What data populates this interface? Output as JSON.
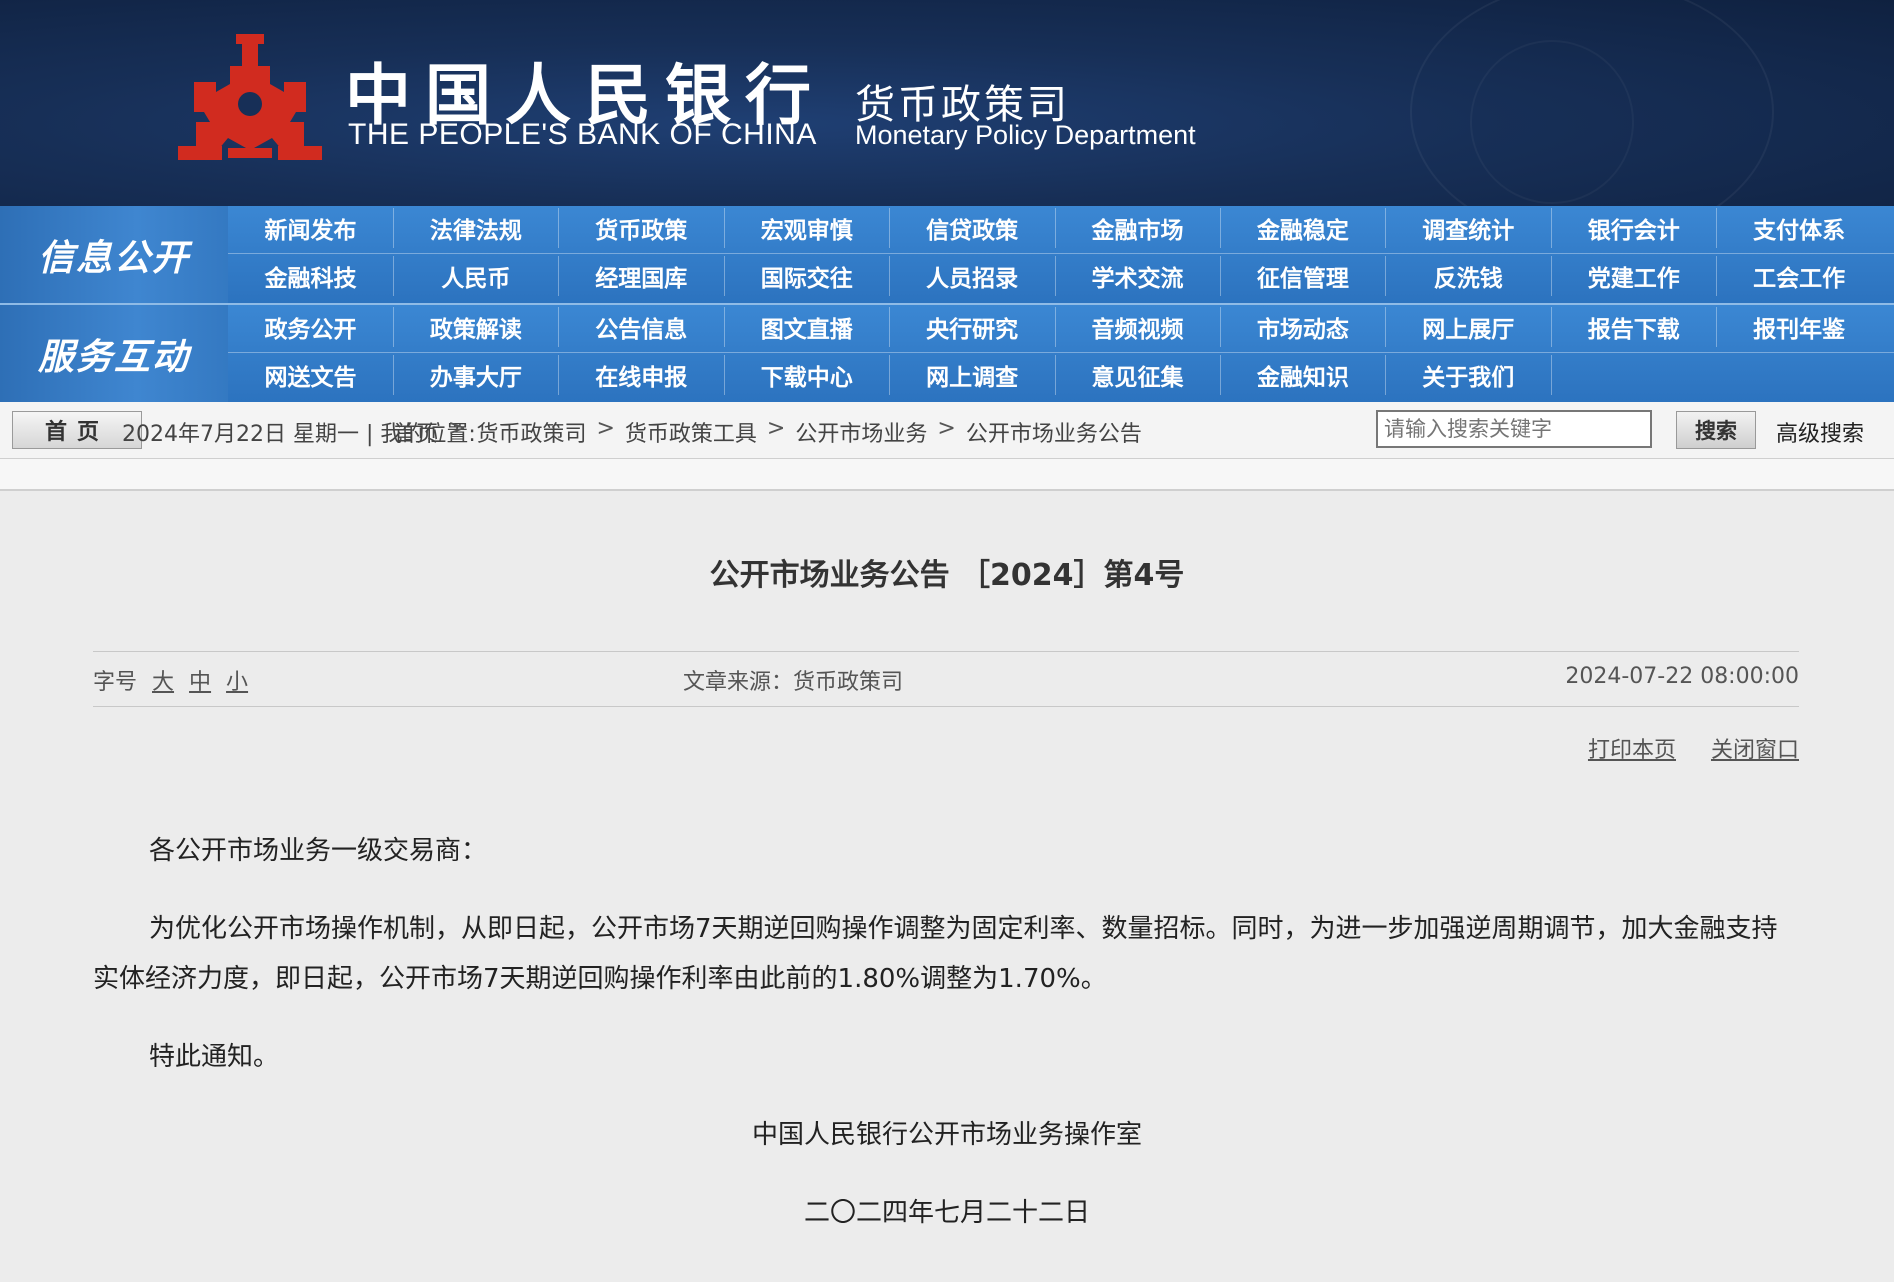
{
  "banner": {
    "bank_name_cn": "中国人民银行",
    "bank_name_en": "THE PEOPLE'S BANK OF CHINA",
    "dept_name_cn": "货币政策司",
    "dept_name_en": "Monetary Policy Department",
    "logo_icon": "pboc-logo-icon",
    "logo_color": "#d12b1f"
  },
  "nav": {
    "sections": [
      {
        "title": "信息公开",
        "rows": [
          [
            "新闻发布",
            "法律法规",
            "货币政策",
            "宏观审慎",
            "信贷政策",
            "金融市场",
            "金融稳定",
            "调查统计",
            "银行会计",
            "支付体系"
          ],
          [
            "金融科技",
            "人民币",
            "经理国库",
            "国际交往",
            "人员招录",
            "学术交流",
            "征信管理",
            "反洗钱",
            "党建工作",
            "工会工作"
          ]
        ]
      },
      {
        "title": "服务互动",
        "rows": [
          [
            "政务公开",
            "政策解读",
            "公告信息",
            "图文直播",
            "央行研究",
            "音频视频",
            "市场动态",
            "网上展厅",
            "报告下载",
            "报刊年鉴"
          ],
          [
            "网送文告",
            "办事大厅",
            "在线申报",
            "下载中心",
            "网上调查",
            "意见征集",
            "金融知识",
            "关于我们"
          ]
        ]
      }
    ]
  },
  "breadcrumb": {
    "home_label": "首页",
    "date_text": "2024年7月22日 星期一 | 我的位置:",
    "path": [
      "首页",
      "货币政策司",
      "货币政策工具",
      "公开市场业务",
      "公开市场业务公告"
    ],
    "separator": ">",
    "search_placeholder": "请输入搜索关键字",
    "search_button": "搜索",
    "advanced_search": "高级搜索"
  },
  "article": {
    "title": "公开市场业务公告 ［2024］第4号",
    "font_size_label": "字号",
    "font_size_options": [
      "大",
      "中",
      "小"
    ],
    "source": "文章来源：货币政策司",
    "publish_time": "2024-07-22 08:00:00",
    "print_label": "打印本页",
    "close_label": "关闭窗口",
    "paragraphs": [
      "各公开市场业务一级交易商：",
      "为优化公开市场操作机制，从即日起，公开市场7天期逆回购操作调整为固定利率、数量招标。同时，为进一步加强逆周期调节，加大金融支持实体经济力度，即日起，公开市场7天期逆回购操作利率由此前的1.80%调整为1.70%。",
      "特此通知。"
    ],
    "signature_org": "中国人民银行公开市场业务操作室",
    "signature_date": "二〇二四年七月二十二日"
  }
}
